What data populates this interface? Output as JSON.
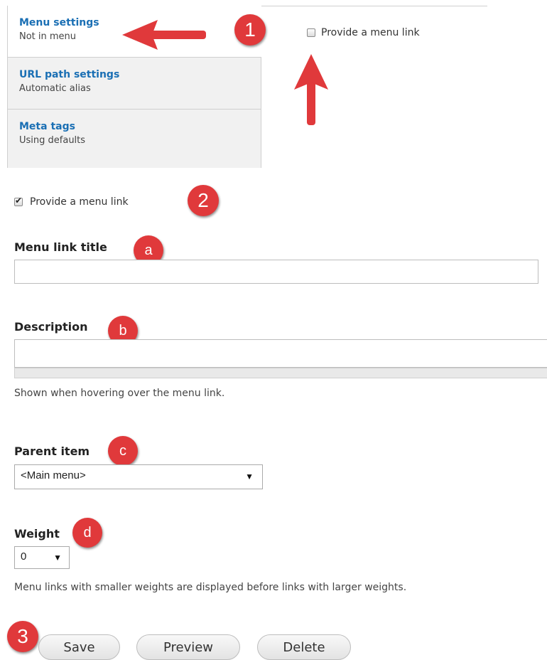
{
  "vertical_tabs": [
    {
      "title": "Menu settings",
      "summary": "Not in menu"
    },
    {
      "title": "URL path settings",
      "summary": "Automatic alias"
    },
    {
      "title": "Meta tags",
      "summary": "Using defaults"
    }
  ],
  "top_checkbox": {
    "label": "Provide a menu link",
    "checked": false
  },
  "menu_checkbox": {
    "label": "Provide a menu link",
    "checked": true
  },
  "fields": {
    "title_label": "Menu link title",
    "title_value": "",
    "description_label": "Description",
    "description_value": "",
    "description_help": "Shown when hovering over the menu link.",
    "parent_label": "Parent item",
    "parent_value": "<Main menu>",
    "weight_label": "Weight",
    "weight_value": "0",
    "weight_help": "Menu links with smaller weights are displayed before links with larger weights."
  },
  "buttons": {
    "save": "Save",
    "preview": "Preview",
    "delete": "Delete"
  },
  "annotations": {
    "step1": "1",
    "step2": "2",
    "step3": "3",
    "a": "a",
    "b": "b",
    "c": "c",
    "d": "d"
  },
  "icons": {
    "arrow": "arrow-icon",
    "caret": "caret-down-icon"
  },
  "colors": {
    "link": "#1a6fb4",
    "badge": "#e0393b",
    "arrow": "#e0393b"
  }
}
